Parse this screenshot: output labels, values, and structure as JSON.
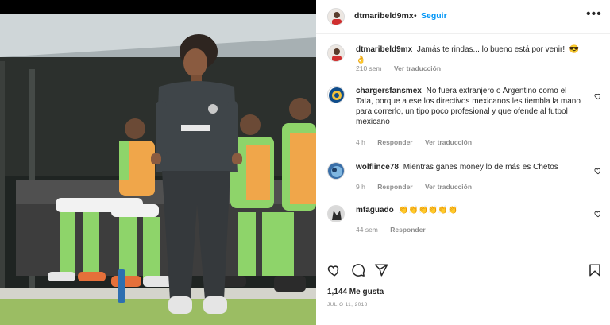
{
  "post": {
    "username": "dtmaribeld9mx",
    "follow_label": "Seguir",
    "separator": "•",
    "more_icon": "more-options-icon",
    "caption": {
      "username": "dtmaribeld9mx",
      "text": "Jamás te rindas... lo bueno está por venir!! 😎👌",
      "time": "210 sem",
      "translate": "Ver traducción"
    },
    "photo": {
      "description_colors": {
        "coach_shirt": "#3f4549",
        "players_kit": "#8ed46a",
        "bench": "#2b2b2b",
        "field": "#9fbf6a"
      }
    }
  },
  "comments": [
    {
      "username": "chargersfansmex",
      "text": "No fuera extranjero o Argentino como el Tata, porque a ese los directivos mexicanos les tiembla la mano para correrlo, un tipo poco profesional y que ofende al futbol mexicano",
      "time": "4 h",
      "reply": "Responder",
      "translate": "Ver traducción"
    },
    {
      "username": "wolflince78",
      "text": "Mientras ganes money lo de más es Chetos",
      "time": "9 h",
      "reply": "Responder",
      "translate": "Ver traducción"
    },
    {
      "username": "mfaguado",
      "text": "👏👏👏👏👏👏",
      "time": "44 sem",
      "reply": "Responder"
    }
  ],
  "actions": {
    "like_icon": "heart-icon",
    "comment_icon": "comment-icon",
    "share_icon": "share-icon",
    "save_icon": "bookmark-icon",
    "likes": "1,144 Me gusta",
    "date": "JULIO 11, 2018"
  },
  "colors": {
    "accent": "#0095f6",
    "text": "#262626",
    "muted": "#8e8e8e",
    "divider": "#efefef"
  }
}
